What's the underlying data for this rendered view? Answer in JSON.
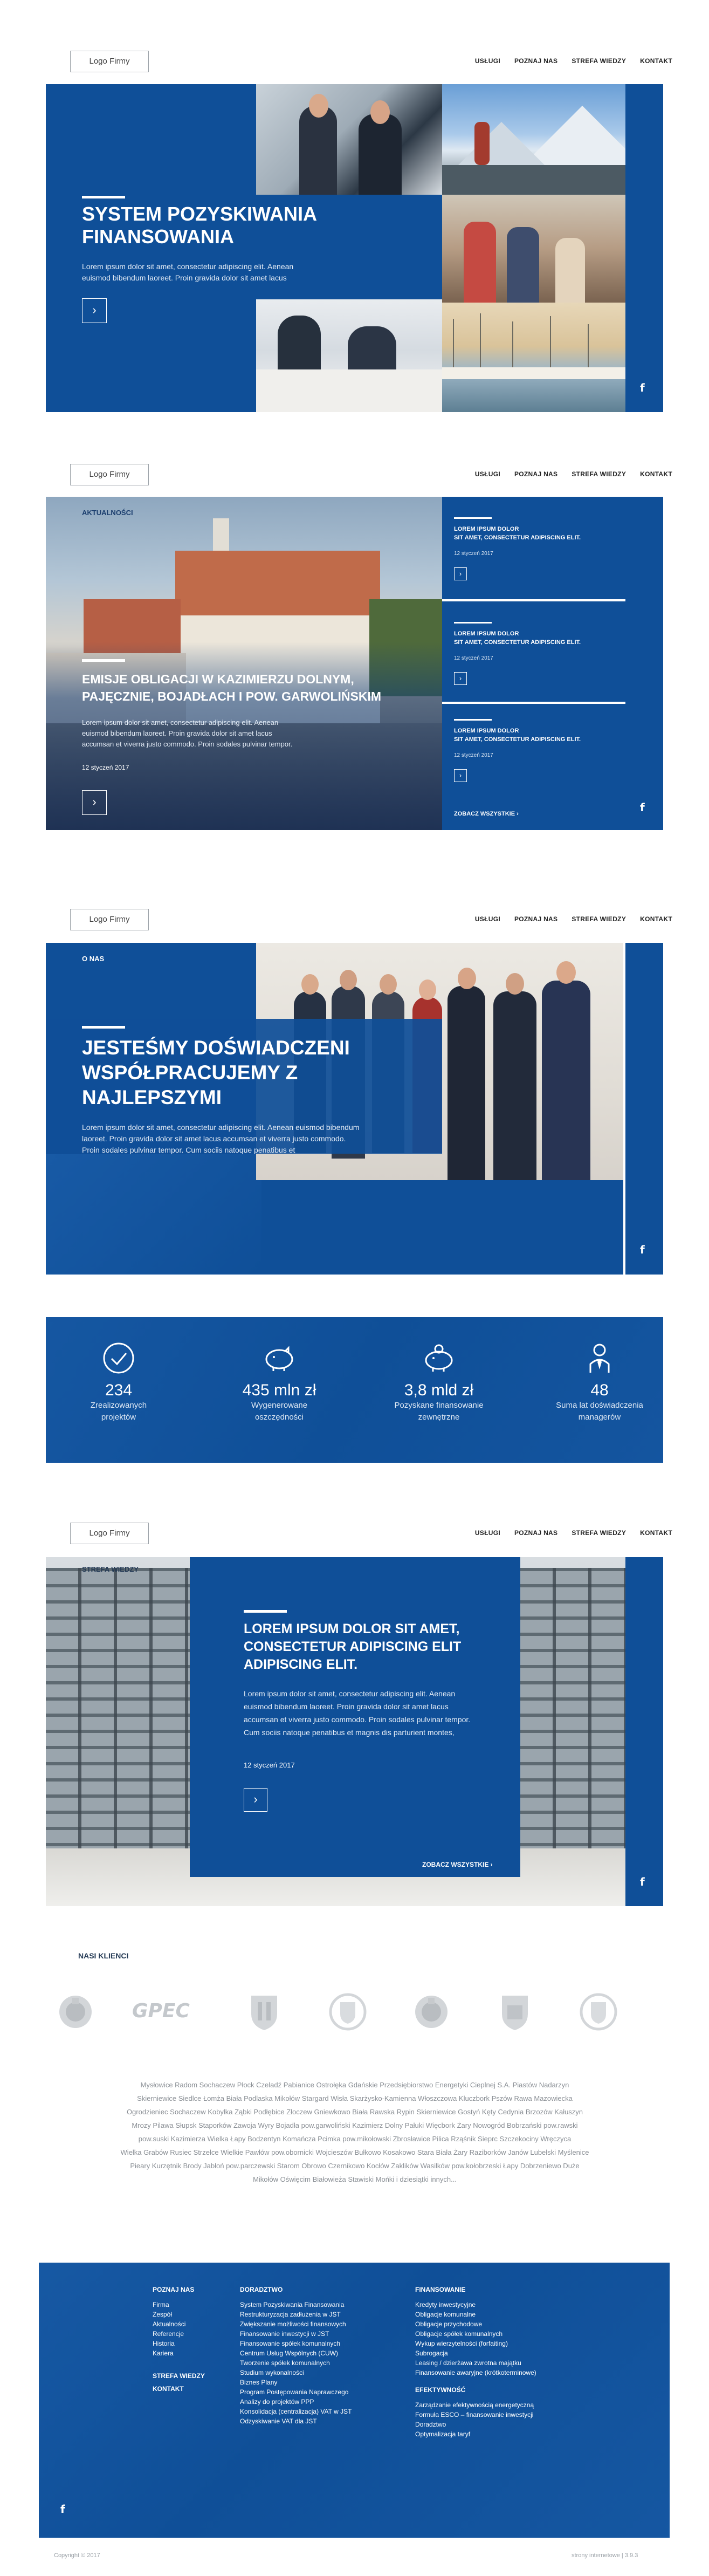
{
  "header": {
    "logo": "Logo Firmy",
    "nav": [
      "USŁUGI",
      "POZNAJ NAS",
      "STREFA WIEDZY",
      "KONTAKT"
    ]
  },
  "hero": {
    "title_line1": "SYSTEM POZYSKIWANIA",
    "title_line2": "FINANSOWANIA",
    "text_line1": "Lorem ipsum dolor sit amet, consectetur adipiscing elit. Aenean",
    "text_line2": "euismod bibendum laoreet. Proin gravida dolor sit amet lacus",
    "arrow": "›",
    "facebook": "f"
  },
  "news": {
    "section_label": "AKTUALNOŚCI",
    "main_title_line1": "EMISJE OBLIGACJI W KAZIMIERZU DOLNYM,",
    "main_title_line2": "PAJĘCZNIE, BOJADŁACH I POW. GARWOLIŃSKIM",
    "main_text_line1": "Lorem ipsum dolor sit amet, consectetur adipiscing elit. Aenean",
    "main_text_line2": "euismod bibendum laoreet. Proin gravida dolor sit amet lacus",
    "main_text_line3": "accumsan et viverra justo commodo. Proin sodales pulvinar tempor.",
    "main_date": "12 styczeń 2017",
    "arrow": "›",
    "items": [
      {
        "title_line1": "LOREM IPSUM DOLOR",
        "title_line2": "SIT AMET, CONSECTETUR ADIPISCING ELIT.",
        "date": "12 styczeń 2017"
      },
      {
        "title_line1": "LOREM IPSUM DOLOR",
        "title_line2": "SIT AMET, CONSECTETUR ADIPISCING ELIT.",
        "date": "12 styczeń 2017"
      },
      {
        "title_line1": "LOREM IPSUM DOLOR",
        "title_line2": "SIT AMET, CONSECTETUR ADIPISCING ELIT.",
        "date": "12 styczeń 2017"
      }
    ],
    "see_all": "ZOBACZ WSZYSTKIE",
    "facebook": "f"
  },
  "about": {
    "section_label": "O NAS",
    "title_line1": "JESTEŚMY DOŚWIADCZENI",
    "title_line2": "WSPÓŁPRACUJEMY Z",
    "title_line3": "NAJLEPSZYMI",
    "text_line1": "Lorem ipsum dolor sit amet, consectetur adipiscing elit. Aenean euismod bibendum",
    "text_line2": "laoreet. Proin gravida dolor sit amet lacus accumsan et viverra justo commodo.",
    "text_line3": "Proin sodales pulvinar tempor. Cum sociis natoque penatibus et",
    "facebook": "f"
  },
  "stats": [
    {
      "icon": "check-circle-icon",
      "value": "234",
      "label_line1": "Zrealizowanych",
      "label_line2": "projektów"
    },
    {
      "icon": "piggy-bank-icon",
      "value": "435 mln zł",
      "label_line1": "Wygenerowane",
      "label_line2": "oszczędności"
    },
    {
      "icon": "piggy-bank-coins-icon",
      "value": "3,8 mld zł",
      "label_line1": "Pozyskane finansowanie",
      "label_line2": "zewnętrzne"
    },
    {
      "icon": "manager-icon",
      "value": "48",
      "label_line1": "Suma lat doświadczenia",
      "label_line2": "managerów"
    }
  ],
  "knowledge": {
    "section_label": "STREFA WIEDZY",
    "title_line1": "LOREM IPSUM DOLOR SIT AMET,",
    "title_line2": "CONSECTETUR ADIPISCING ELIT",
    "title_line3": "ADIPISCING ELIT.",
    "text_line1": "Lorem ipsum dolor sit amet, consectetur adipiscing elit. Aenean",
    "text_line2": "euismod bibendum laoreet. Proin gravida dolor sit amet lacus",
    "text_line3": "accumsan et viverra justo commodo. Proin sodales pulvinar tempor.",
    "text_line4": "Cum sociis natoque penatibus et magnis dis parturient montes,",
    "date": "12 styczeń 2017",
    "arrow": "›",
    "see_all": "ZOBACZ WSZYSTKIE",
    "facebook": "f"
  },
  "clients": {
    "title": "NASI KLIENCI",
    "logo_text": "GPEC",
    "list": [
      "Mysłowice Radom Sochaczew Płock Czeladź Pabianice Ostrołęka Gdańskie Przedsiębiorstwo Energetyki Cieplnej S.A. Piastów Nadarzyn",
      "Skierniewice Siedlce Łomża Biała Podlaska Mikołów Stargard Wisła Skarżysko-Kamienna Włoszczowa Kluczbork Pszów Rawa Mazowiecka",
      "Ogrodzieniec Sochaczew Kobyłka Ząbki Podłębice Złoczew Gniewkowo Biała Rawska Rypin Skierniewice Gostyń Kęty Cedynia Brzozów Kałuszyn",
      "Mrozy Pilawa Słupsk Staporków Zawoja Wyry Bojadła pow.garwoliński Kazimierz Dolny Pałuki Więcbork Żary Nowogród Bobrzański pow.rawski",
      "pow.suski Kazimierza Wielka Łapy Bodzentyn Komańcza Pcimka pow.mikołowski Zbrosławice Pilica Rząśnik Sieprc Szczekociny Wręczyca",
      "Wielka Grabów Rusiec Strzelce Wielkie Pawłów pow.obornicki Wojcieszów Bułkowo Kosakowo Stara Biała Żary Raziborków Janów Lubelski Myślenice",
      "Pieary Kurzętnik Brody Jabłoń pow.parczewski Starom Obrowo Czernikowo Kocłów Zaklików Wasilków pow.kołobrzeski Łapy Dobrzeniewo Duże",
      "Mikołów Oświęcim Białowieża Stawiski Mońki i dziesiątki innych..."
    ]
  },
  "footer": {
    "col1": {
      "heading": "POZNAJ NAS",
      "items": [
        "Firma",
        "Zespół",
        "Aktualności",
        "Referencje",
        "Historia",
        "Kariera"
      ],
      "extra1": "STREFA WIEDZY",
      "extra2": "KONTAKT"
    },
    "col2": {
      "heading": "DORADZTWO",
      "items": [
        "System Pozyskiwania Finansowania",
        "Restrukturyzacja zadłużenia w JST",
        "Zwiększanie możliwości finansowych",
        "Finansowanie inwestycji w JST",
        "Finansowanie spółek komunalnych",
        "Centrum Usług Wspólnych (CUW)",
        "Tworzenie spółek komunalnych",
        "Studium wykonalności",
        "Biznes Plany",
        "Program Postępowania Naprawczego",
        "Analizy do projektów PPP",
        "Konsolidacja (centralizacja) VAT w JST",
        "Odzyskiwanie VAT dla JST"
      ]
    },
    "col3": {
      "heading": "FINANSOWANIE",
      "items": [
        "Kredyty inwestycyjne",
        "Obligacje komunalne",
        "Obligacje przychodowe",
        "Obligacje spółek komunalnych",
        "Wykup wierzytelności (forfaiting)",
        "Subrogacja",
        "Leasing / dzierżawa zwrotna majątku",
        "Finansowanie awaryjne (krótkoterminowe)"
      ],
      "heading2": "EFEKTYWNOŚĆ",
      "items2": [
        "Zarządzanie efektywnością energetyczną",
        "Formuła ESCO – finansowanie inwestycji",
        "Doradztwo",
        "Optymalizacja taryf"
      ]
    },
    "facebook": "f",
    "copyright": "Copyright © 2017",
    "credit": "strony internetowe  |  3.9.3"
  },
  "colors": {
    "brand_blue": "#0f4f98",
    "dark_blue": "#0b3f7e"
  }
}
